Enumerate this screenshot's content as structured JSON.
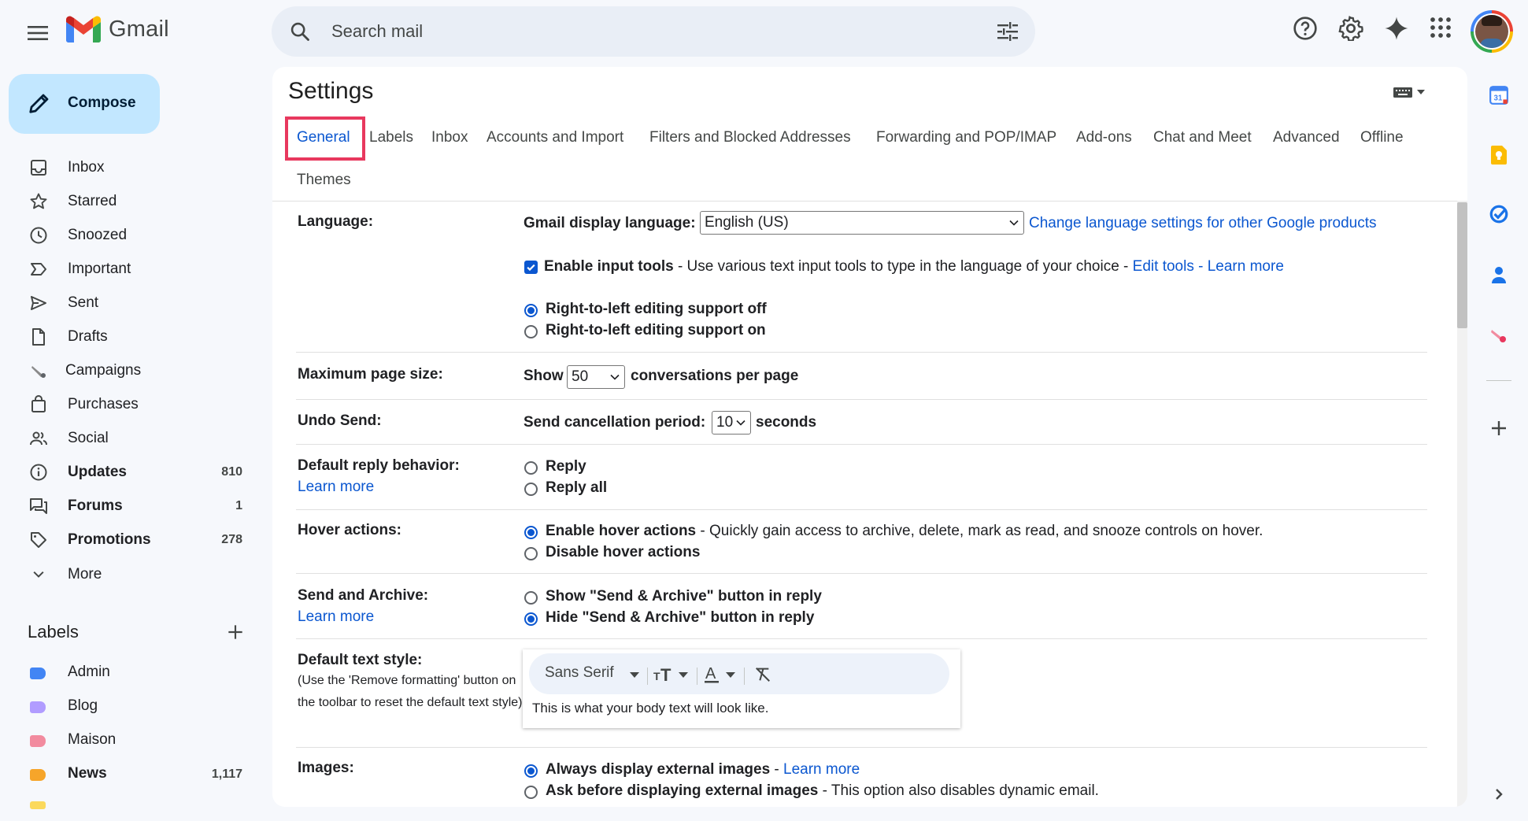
{
  "app": {
    "name": "Gmail"
  },
  "search": {
    "placeholder": "Search mail"
  },
  "compose": {
    "label": "Compose"
  },
  "sidebar": {
    "items": [
      {
        "label": "Inbox",
        "icon": "inbox-icon"
      },
      {
        "label": "Starred",
        "icon": "star-icon"
      },
      {
        "label": "Snoozed",
        "icon": "clock-icon"
      },
      {
        "label": "Important",
        "icon": "important-icon"
      },
      {
        "label": "Sent",
        "icon": "send-icon"
      },
      {
        "label": "Drafts",
        "icon": "draft-icon"
      },
      {
        "label": "Campaigns",
        "icon": "campaigns-icon"
      },
      {
        "label": "Purchases",
        "icon": "shopping-bag-icon"
      },
      {
        "label": "Social",
        "icon": "people-icon"
      },
      {
        "label": "Updates",
        "icon": "info-icon",
        "count": "810"
      },
      {
        "label": "Forums",
        "icon": "forum-icon",
        "count": "1"
      },
      {
        "label": "Promotions",
        "icon": "tag-icon",
        "count": "278"
      },
      {
        "label": "More",
        "icon": "chevron-down-icon"
      }
    ],
    "labels_heading": "Labels",
    "labels": [
      {
        "label": "Admin",
        "color": "#4285f4"
      },
      {
        "label": "Blog",
        "color": "#b19cff"
      },
      {
        "label": "Maison",
        "color": "#f28b9f"
      },
      {
        "label": "News",
        "color": "#f6a52a",
        "count": "1,117"
      }
    ]
  },
  "settings": {
    "title": "Settings",
    "tabs": [
      "General",
      "Labels",
      "Inbox",
      "Accounts and Import",
      "Filters and Blocked Addresses",
      "Forwarding and POP/IMAP",
      "Add-ons",
      "Chat and Meet",
      "Advanced",
      "Offline",
      "Themes"
    ],
    "active_tab": "General",
    "language": {
      "label": "Language:",
      "display_label": "Gmail display language:",
      "display_value": "English (US)",
      "change_link": "Change language settings for other Google products",
      "input_tools_label": "Enable input tools",
      "input_tools_desc": " - Use various text input tools to type in the language of your choice - ",
      "edit_tools": "Edit tools",
      "dash": " - ",
      "learn_more": "Learn more",
      "rtl_off": "Right-to-left editing support off",
      "rtl_on": "Right-to-left editing support on"
    },
    "page_size": {
      "label": "Maximum page size:",
      "show": "Show",
      "value": "50",
      "suffix": "conversations per page"
    },
    "undo_send": {
      "label": "Undo Send:",
      "prefix": "Send cancellation period:",
      "value": "10",
      "suffix": "seconds"
    },
    "reply": {
      "label": "Default reply behavior:",
      "learn_more": "Learn more",
      "opt1": "Reply",
      "opt2": "Reply all"
    },
    "hover": {
      "label": "Hover actions:",
      "opt1": "Enable hover actions",
      "opt1_desc": " - Quickly gain access to archive, delete, mark as read, and snooze controls on hover.",
      "opt2": "Disable hover actions"
    },
    "send_archive": {
      "label": "Send and Archive:",
      "learn_more": "Learn more",
      "opt1": "Show \"Send & Archive\" button in reply",
      "opt2": "Hide \"Send & Archive\" button in reply"
    },
    "text_style": {
      "label": "Default text style:",
      "note": "(Use the 'Remove formatting' button on the toolbar to reset the default text style)",
      "font": "Sans Serif",
      "preview": "This is what your body text will look like."
    },
    "images": {
      "label": "Images:",
      "opt1": "Always display external images",
      "opt1_link": "Learn more",
      "opt2": "Ask before displaying external images",
      "opt2_desc": " - This option also disables dynamic email."
    }
  },
  "colors": {
    "accent": "#0b57d0",
    "compose_bg": "#c2e7ff",
    "highlight": "#e8385e",
    "bg": "#f6f8fc"
  }
}
